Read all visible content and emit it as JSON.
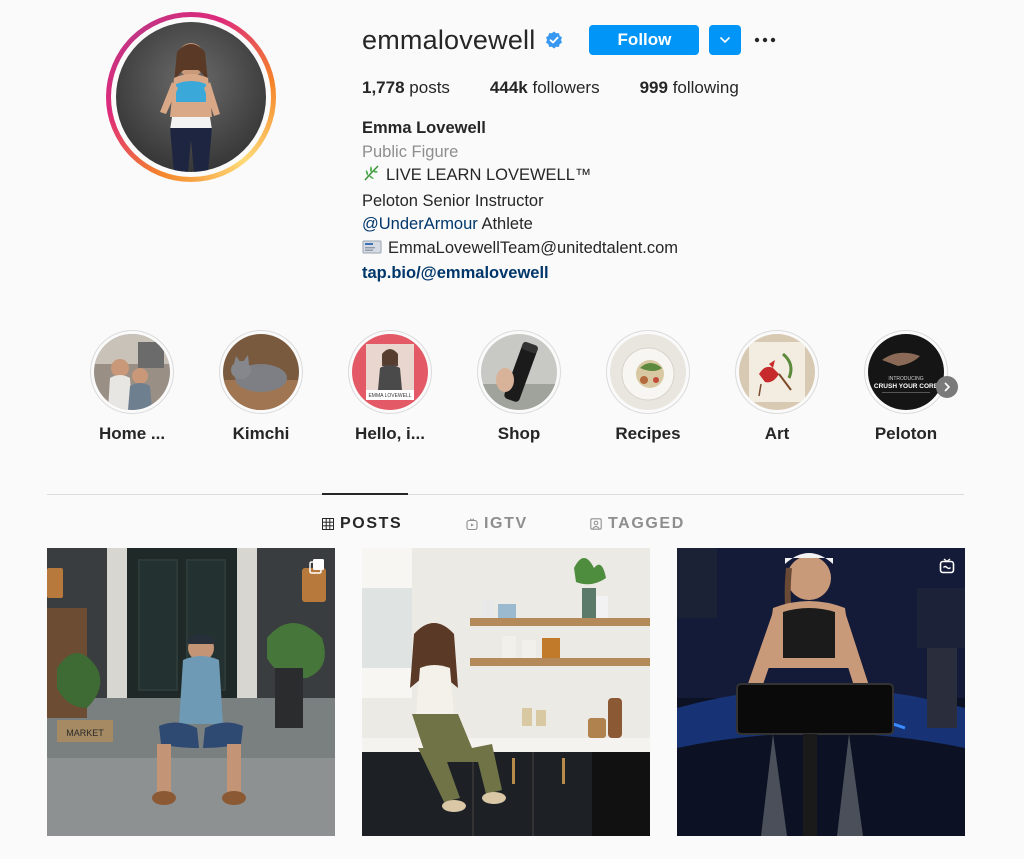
{
  "profile": {
    "username": "emmalovewell",
    "follow_label": "Follow",
    "stats": [
      {
        "count": "1,778",
        "label": "posts"
      },
      {
        "count": "444k",
        "label": "followers"
      },
      {
        "count": "999",
        "label": "following"
      }
    ],
    "bio": {
      "name": "Emma Lovewell",
      "category": "Public Figure",
      "line1": "LIVE LEARN LOVEWELL™",
      "line2": "Peloton Senior Instructor",
      "mention": "@UnderArmour",
      "line3_suffix": " Athlete",
      "email": "EmmaLovewellTeam@unitedtalent.com",
      "link": "tap.bio/@emmalovewell"
    }
  },
  "highlights": [
    {
      "label": "Home ...",
      "icon": "home-highlight-image"
    },
    {
      "label": "Kimchi",
      "icon": "cat-highlight-image"
    },
    {
      "label": "Hello, i...",
      "icon": "hello-highlight-image"
    },
    {
      "label": "Shop",
      "icon": "shop-highlight-image"
    },
    {
      "label": "Recipes",
      "icon": "recipes-highlight-image"
    },
    {
      "label": "Art",
      "icon": "art-highlight-image"
    },
    {
      "label": "Peloton",
      "icon": "peloton-highlight-image"
    }
  ],
  "peloton_highlight_text": {
    "line1": "INTRODUCING",
    "line2": "CRUSH YOUR CORE"
  },
  "hello_highlight_text": "EMMA LOVEWELL",
  "tabs": [
    {
      "label": "POSTS",
      "icon": "grid-icon",
      "active": true
    },
    {
      "label": "IGTV",
      "icon": "igtv-icon",
      "active": false
    },
    {
      "label": "TAGGED",
      "icon": "tagged-icon",
      "active": false
    }
  ],
  "posts_signs": {
    "market": "MARKET"
  },
  "colors": {
    "accent": "#0095f6",
    "link": "#00376b",
    "muted": "#8e8e8e",
    "text": "#262626"
  }
}
